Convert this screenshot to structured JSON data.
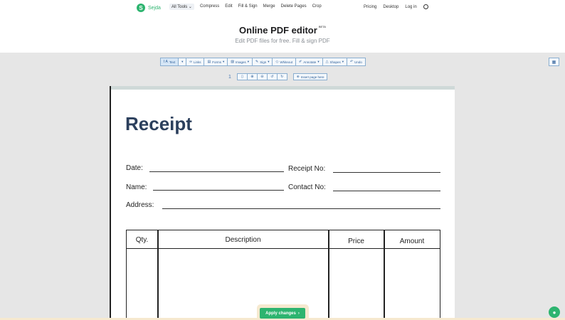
{
  "brand": {
    "name": "Sejda",
    "mark": "S"
  },
  "nav": {
    "left": [
      "All Tools",
      "Compress",
      "Edit",
      "Fill & Sign",
      "Merge",
      "Delete Pages",
      "Crop"
    ],
    "right": [
      "Pricing",
      "Desktop",
      "Log in"
    ]
  },
  "hero": {
    "title": "Online PDF editor",
    "badge": "BETA",
    "subtitle": "Edit PDF files for free. Fill & sign PDF"
  },
  "toolbar": {
    "text": "Text",
    "links": "Links",
    "forms": "Forms",
    "images": "Images",
    "sign": "Sign",
    "whiteout": "Whiteout",
    "annotate": "Annotate",
    "shapes": "Shapes",
    "undo": "Undo"
  },
  "pagebar": {
    "page_number": "1",
    "insert": "Insert page here"
  },
  "document": {
    "title": "Receipt",
    "date_label": "Date:",
    "receipt_no_label": "Receipt No:",
    "name_label": "Name:",
    "contact_no_label": "Contact No:",
    "address_label": "Address:",
    "columns": [
      "Qty.",
      "Description",
      "Price",
      "Amount"
    ]
  },
  "apply": {
    "label": "Apply changes"
  },
  "colors": {
    "accent": "#2db46f",
    "toolbar_blue": "#2d5f99",
    "receipt_title": "#2b3f5c"
  }
}
